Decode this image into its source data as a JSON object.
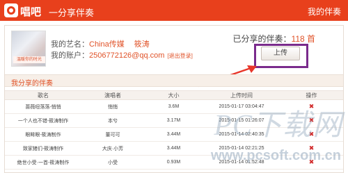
{
  "header": {
    "logo_text": "唱吧",
    "page_heading": "一分享伴奏",
    "my_songs_link": "我的伴奏"
  },
  "profile": {
    "avatar_caption": "温暖你的时光",
    "name_label": "我的艺名：",
    "name_value": "China传媒",
    "name_extra": "筱涛",
    "account_label": "我的账户：",
    "account_value": "2506772126@qq.com",
    "logout_label": "[退出登录]"
  },
  "stats": {
    "shared_label": "已分享的伴奏：",
    "shared_count": "118 首",
    "upload_button": "上传"
  },
  "section": {
    "title": "我分享的伴奏"
  },
  "table": {
    "headers": [
      "歌名",
      "演唱者",
      "大小",
      "上传时间",
      "操作"
    ],
    "rows": [
      {
        "song": "蔷薇纽落落-悄悄",
        "singer": "悄悄",
        "size": "3.6M",
        "time": "2015-01-17 03:04:47"
      },
      {
        "song": "一个人也不错-筱涛制作",
        "singer": "本兮",
        "size": "3.17M",
        "time": "2015-01-15 01:26:07"
      },
      {
        "song": "眼眸眼-筱涛制作",
        "singer": "董可可",
        "size": "3.44M",
        "time": "2015-01-14 02:40:35"
      },
      {
        "song": "致家猪们-筱涛制作",
        "singer": "大庆·小芳",
        "size": "3.44M",
        "time": "2015-01-14 02:21:25"
      },
      {
        "song": "绝世小受·一首-筱涛制作",
        "singer": "小受",
        "size": "0.93M",
        "time": "2015-01-14 01:52:48"
      }
    ],
    "delete_glyph": "✖"
  },
  "watermark": {
    "text": "PC下载网",
    "url": "www.pcsoft.com.cn"
  },
  "colors": {
    "brand": "#e8401c",
    "accent_text": "#e05228",
    "highlight_box": "#7a2b8c",
    "arrow": "#e8362a"
  }
}
